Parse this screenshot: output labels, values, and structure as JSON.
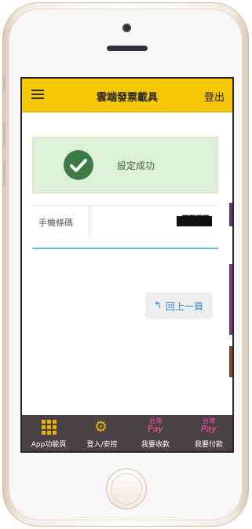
{
  "topbar": {
    "title": "雲端發票載具",
    "logout_label": "登出"
  },
  "status": {
    "message": "設定成功",
    "color": "#dff0d8"
  },
  "form": {
    "phone_label": "手機條碼",
    "phone_value": "/████"
  },
  "actions": {
    "back_arrow": "↰",
    "back_label": "回上一頁"
  },
  "bottom_nav": {
    "tabs": [
      {
        "label": "App功能頁",
        "icon": "grid-icon"
      },
      {
        "label": "登入/安控",
        "icon": "gear-icon"
      },
      {
        "label": "我要收款",
        "icon": "taiwan-pay-icon",
        "logo_line1": "台灣",
        "logo_line2": "Pay"
      },
      {
        "label": "我要付款",
        "icon": "taiwan-pay-icon",
        "logo_line1": "台灣",
        "logo_line2": "Pay"
      }
    ]
  },
  "colors": {
    "accent": "#f5c707",
    "nav_bg": "#4a4346",
    "link": "#3a87c4",
    "pay_pink": "#ff4fa0"
  }
}
